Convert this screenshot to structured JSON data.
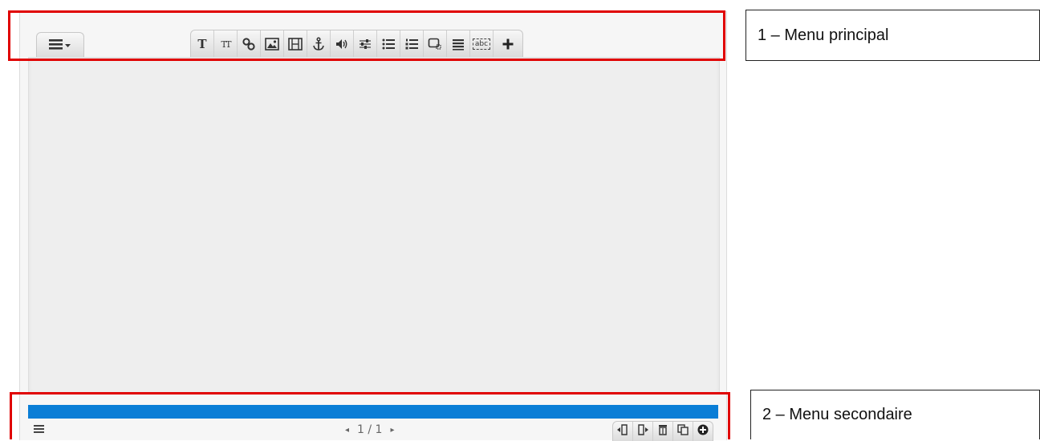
{
  "toolbar": {
    "tools": [
      {
        "name": "text-icon",
        "label": "T"
      },
      {
        "name": "text-style-icon",
        "label": "TT"
      },
      {
        "name": "link-icon"
      },
      {
        "name": "image-icon"
      },
      {
        "name": "video-icon"
      },
      {
        "name": "anchor-icon"
      },
      {
        "name": "audio-icon"
      },
      {
        "name": "sliders-icon"
      },
      {
        "name": "bullet-list-icon"
      },
      {
        "name": "numbered-list-icon"
      },
      {
        "name": "popup-icon"
      },
      {
        "name": "lines-icon"
      },
      {
        "name": "text-field-icon",
        "label": "abc"
      },
      {
        "name": "plus-icon"
      }
    ]
  },
  "progress": {
    "fraction": 1.0,
    "color": "#0a7ed6"
  },
  "pager": {
    "text": "1 / 1",
    "prev": "◂",
    "next": "▸"
  },
  "callouts": {
    "main": "1 – Menu principal",
    "secondary": "2 – Menu secondaire"
  },
  "colors": {
    "highlight": "#e00000",
    "accent": "#0a7ed6"
  }
}
